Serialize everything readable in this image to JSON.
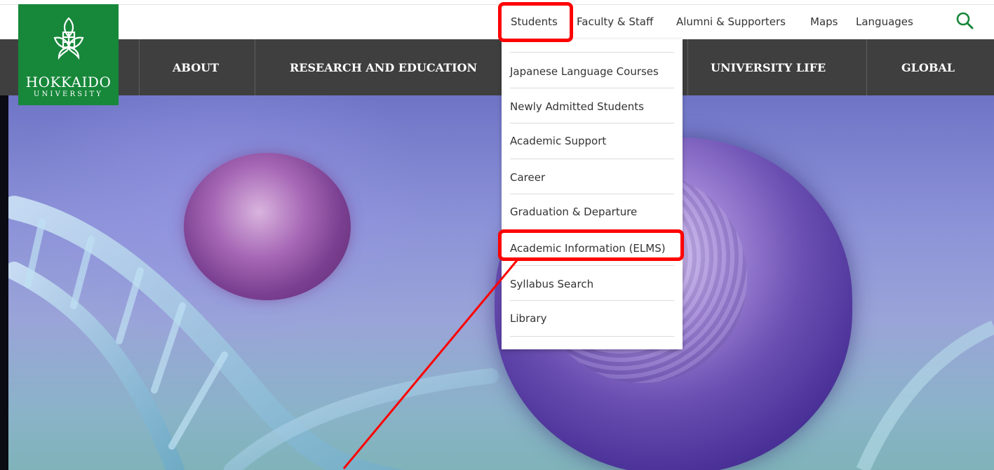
{
  "utility_nav": {
    "students": "Students",
    "faculty_staff": "Faculty & Staff",
    "alumni_supporters": "Alumni & Supporters",
    "maps": "Maps",
    "languages": "Languages"
  },
  "logo": {
    "name": "HOKKAIDO",
    "sub": "UNIVERSITY"
  },
  "main_nav": {
    "about": "ABOUT",
    "research_education": "RESEARCH AND EDUCATION",
    "university_life": "UNIVERSITY LIFE",
    "global": "GLOBAL"
  },
  "students_menu": {
    "items": [
      "Japanese Language Courses",
      "Newly Admitted Students",
      "Academic Support",
      "Career",
      "Graduation & Departure",
      "Academic Information (ELMS)",
      "Syllabus Search",
      "Library"
    ]
  },
  "colors": {
    "logo_green": "#17873a",
    "nav_bg": "#3f3f3f",
    "highlight": "#ff0000"
  },
  "icons": [
    "search-icon",
    "university-crest-icon"
  ]
}
